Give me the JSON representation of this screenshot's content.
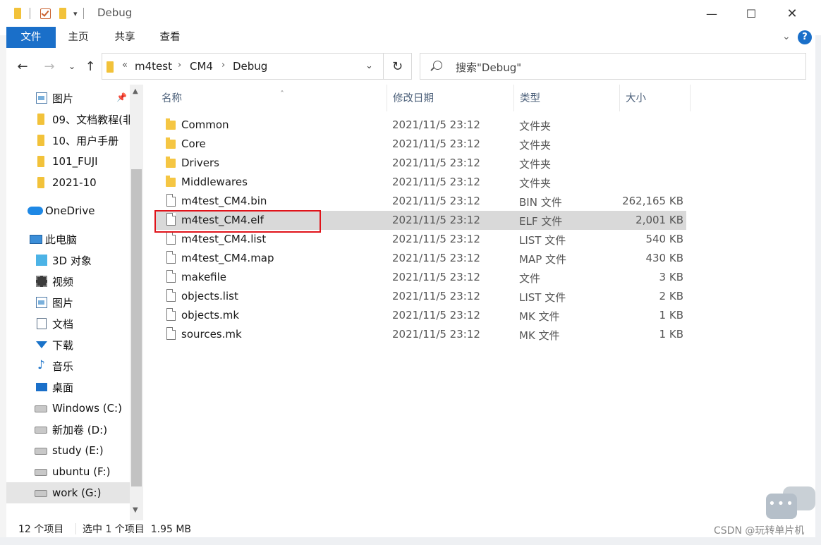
{
  "window": {
    "title": "Debug"
  },
  "ribbon": {
    "tabs": [
      "文件",
      "主页",
      "共享",
      "查看"
    ],
    "help": "?"
  },
  "address": {
    "crumbs": [
      "m4test",
      "CM4",
      "Debug"
    ],
    "overflow": "«"
  },
  "search": {
    "placeholder": "搜索\"Debug\""
  },
  "nav": {
    "items": [
      {
        "label": "图片",
        "icon": "pictures-icon",
        "pinned": true
      },
      {
        "label": "09、文档教程(非",
        "icon": "folder-icon"
      },
      {
        "label": "10、用户手册",
        "icon": "folder-icon"
      },
      {
        "label": "101_FUJI",
        "icon": "folder-icon"
      },
      {
        "label": "2021-10",
        "icon": "folder-icon"
      },
      {
        "label": "OneDrive",
        "icon": "onedrive-icon"
      },
      {
        "label": "此电脑",
        "icon": "this-pc-icon"
      },
      {
        "label": "3D 对象",
        "icon": "3d-objects-icon"
      },
      {
        "label": "视频",
        "icon": "videos-icon"
      },
      {
        "label": "图片",
        "icon": "pictures-icon"
      },
      {
        "label": "文档",
        "icon": "documents-icon"
      },
      {
        "label": "下载",
        "icon": "downloads-icon"
      },
      {
        "label": "音乐",
        "icon": "music-icon"
      },
      {
        "label": "桌面",
        "icon": "desktop-icon"
      },
      {
        "label": "Windows (C:)",
        "icon": "drive-icon"
      },
      {
        "label": "新加卷 (D:)",
        "icon": "drive-icon"
      },
      {
        "label": "study (E:)",
        "icon": "drive-icon"
      },
      {
        "label": "ubuntu (F:)",
        "icon": "drive-icon"
      },
      {
        "label": "work (G:)",
        "icon": "drive-icon",
        "selected": true
      }
    ]
  },
  "columns": [
    "名称",
    "修改日期",
    "类型",
    "大小"
  ],
  "files": [
    {
      "name": "Common",
      "date": "2021/11/5 23:12",
      "type": "文件夹",
      "size": "",
      "kind": "folder"
    },
    {
      "name": "Core",
      "date": "2021/11/5 23:12",
      "type": "文件夹",
      "size": "",
      "kind": "folder"
    },
    {
      "name": "Drivers",
      "date": "2021/11/5 23:12",
      "type": "文件夹",
      "size": "",
      "kind": "folder"
    },
    {
      "name": "Middlewares",
      "date": "2021/11/5 23:12",
      "type": "文件夹",
      "size": "",
      "kind": "folder"
    },
    {
      "name": "m4test_CM4.bin",
      "date": "2021/11/5 23:12",
      "type": "BIN 文件",
      "size": "262,165 KB",
      "kind": "file"
    },
    {
      "name": "m4test_CM4.elf",
      "date": "2021/11/5 23:12",
      "type": "ELF 文件",
      "size": "2,001 KB",
      "kind": "file",
      "selected": true
    },
    {
      "name": "m4test_CM4.list",
      "date": "2021/11/5 23:12",
      "type": "LIST 文件",
      "size": "540 KB",
      "kind": "file"
    },
    {
      "name": "m4test_CM4.map",
      "date": "2021/11/5 23:12",
      "type": "MAP 文件",
      "size": "430 KB",
      "kind": "file"
    },
    {
      "name": "makefile",
      "date": "2021/11/5 23:12",
      "type": "文件",
      "size": "3 KB",
      "kind": "file"
    },
    {
      "name": "objects.list",
      "date": "2021/11/5 23:12",
      "type": "LIST 文件",
      "size": "2 KB",
      "kind": "file"
    },
    {
      "name": "objects.mk",
      "date": "2021/11/5 23:12",
      "type": "MK 文件",
      "size": "1 KB",
      "kind": "file"
    },
    {
      "name": "sources.mk",
      "date": "2021/11/5 23:12",
      "type": "MK 文件",
      "size": "1 KB",
      "kind": "file"
    }
  ],
  "status": {
    "count": "12 个项目",
    "selection": "选中 1 个项目  1.95 MB"
  },
  "watermark": "CSDN @玩转单片机",
  "colors": {
    "accent": "#1a6fc9",
    "highlight_box": "#e0131a",
    "selected_row": "#d9d9d9",
    "folder": "#f5c643"
  }
}
